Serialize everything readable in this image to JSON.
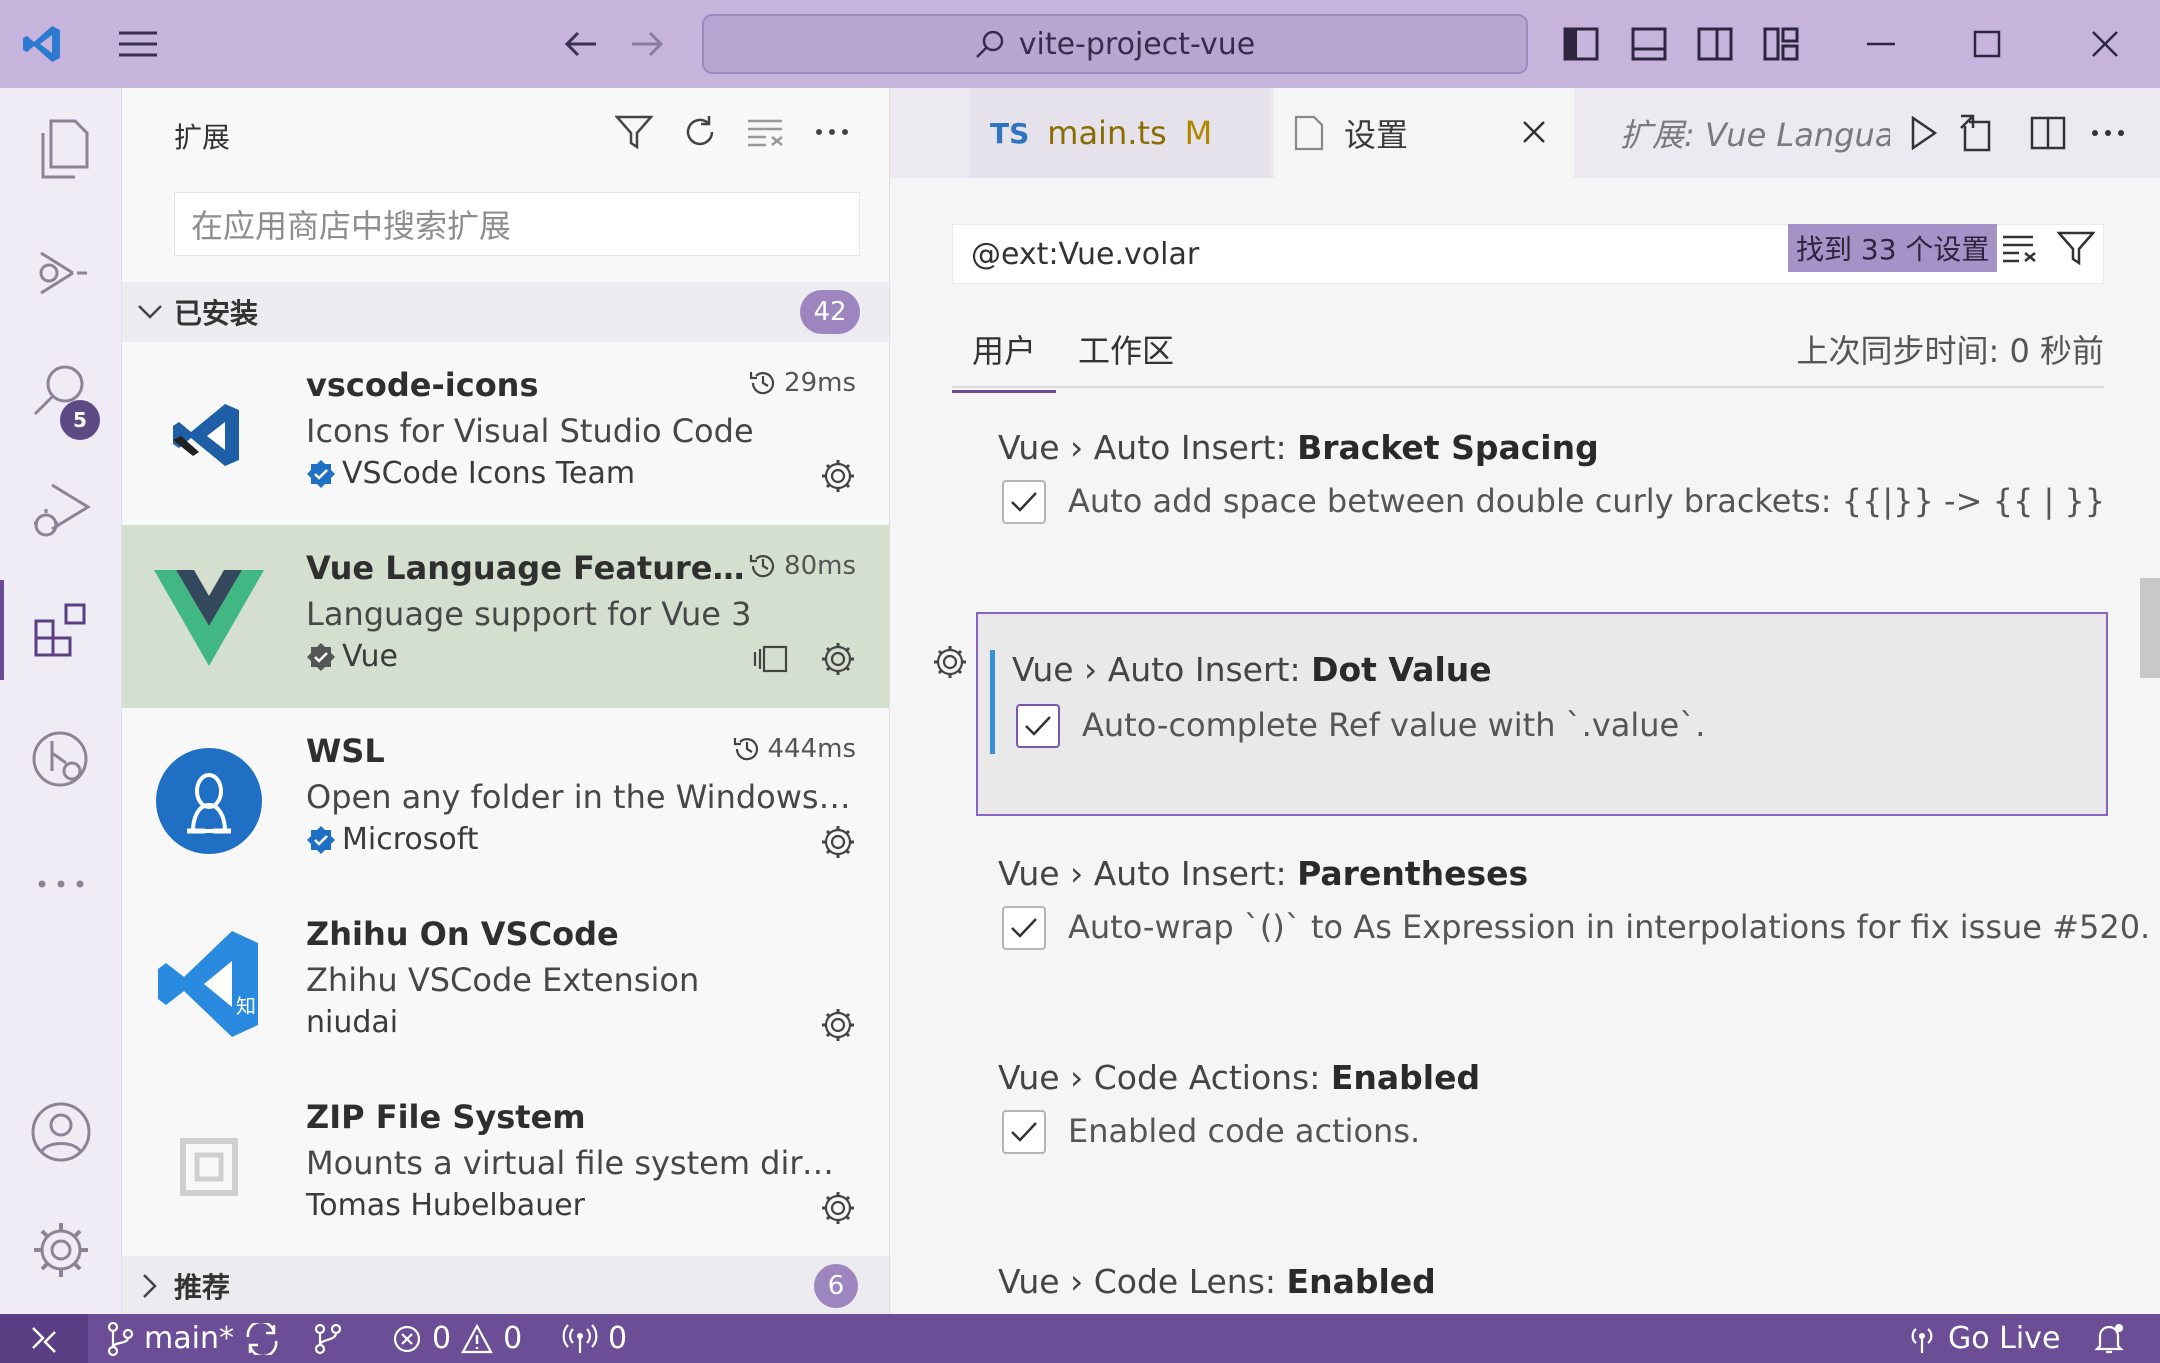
{
  "window": {
    "command_center": "vite-project-vue",
    "colors": {
      "titlebar": "#c7b4dd",
      "statusbar": "#6b4e96",
      "accent": "#6c4c96"
    }
  },
  "activity_bar": {
    "items": [
      {
        "name": "explorer",
        "icon": "files-icon"
      },
      {
        "name": "source-control",
        "icon": "source-control-icon"
      },
      {
        "name": "search",
        "icon": "search-icon",
        "badge": "5"
      },
      {
        "name": "run-debug",
        "icon": "run-debug-icon"
      },
      {
        "name": "extensions",
        "icon": "extensions-icon",
        "active": true
      },
      {
        "name": "remote-explorer",
        "icon": "remote-explorer-icon"
      },
      {
        "name": "more",
        "icon": "more-icon"
      }
    ],
    "bottom": [
      {
        "name": "accounts",
        "icon": "account-icon"
      },
      {
        "name": "manage",
        "icon": "gear-icon"
      }
    ]
  },
  "sidebar": {
    "title": "扩展",
    "search_placeholder": "在应用商店中搜索扩展",
    "installed": {
      "label": "已安装",
      "count": "42"
    },
    "recommended": {
      "label": "推荐",
      "count": "6"
    },
    "extensions": [
      {
        "name": "vscode-icons",
        "description": "Icons for Visual Studio Code",
        "publisher": "VSCode Icons Team",
        "verified": true,
        "time": "29ms"
      },
      {
        "name": "Vue Language Features (V...",
        "description": "Language support for Vue 3",
        "publisher": "Vue",
        "verified": true,
        "time": "80ms",
        "selected": true
      },
      {
        "name": "WSL",
        "description": "Open any folder in the Windows Su...",
        "publisher": "Microsoft",
        "verified": true,
        "time": "444ms"
      },
      {
        "name": "Zhihu On VSCode",
        "description": "Zhihu VSCode Extension",
        "publisher": "niudai",
        "verified": false,
        "time": ""
      },
      {
        "name": "ZIP File System",
        "description": "Mounts a virtual file system director...",
        "publisher": "Tomas Hubelbauer",
        "verified": false,
        "time": ""
      }
    ]
  },
  "tabs": [
    {
      "badge": "TS",
      "label": "main.ts",
      "modified": "M"
    },
    {
      "label": "设置",
      "active": true
    },
    {
      "label": "扩展: Vue Language Features (Volar)"
    }
  ],
  "settings": {
    "query": "@ext:Vue.volar",
    "found": "找到 33 个设置",
    "scope_tabs": [
      "用户",
      "工作区"
    ],
    "sync_status": "上次同步时间: 0 秒前",
    "items": [
      {
        "category": "Vue › Auto Insert: ",
        "name": "Bracket Spacing",
        "description": "Auto add space between double curly brackets: {{|}} -> {{ | }}",
        "checked": true
      },
      {
        "category": "Vue › Auto Insert: ",
        "name": "Dot Value",
        "description": "Auto-complete Ref value with `.value`.",
        "checked": true,
        "focused": true
      },
      {
        "category": "Vue › Auto Insert: ",
        "name": "Parentheses",
        "description": "Auto-wrap `()` to As Expression in interpolations for fix issue #520.",
        "checked": true
      },
      {
        "category": "Vue › Code Actions: ",
        "name": "Enabled",
        "description": "Enabled code actions.",
        "checked": true
      },
      {
        "category": "Vue › Code Lens: ",
        "name": "Enabled",
        "description": "",
        "checked": true
      }
    ]
  },
  "statusbar": {
    "branch": "main*",
    "errors": "0",
    "warnings": "0",
    "ports": "0",
    "go_live": "Go Live"
  }
}
